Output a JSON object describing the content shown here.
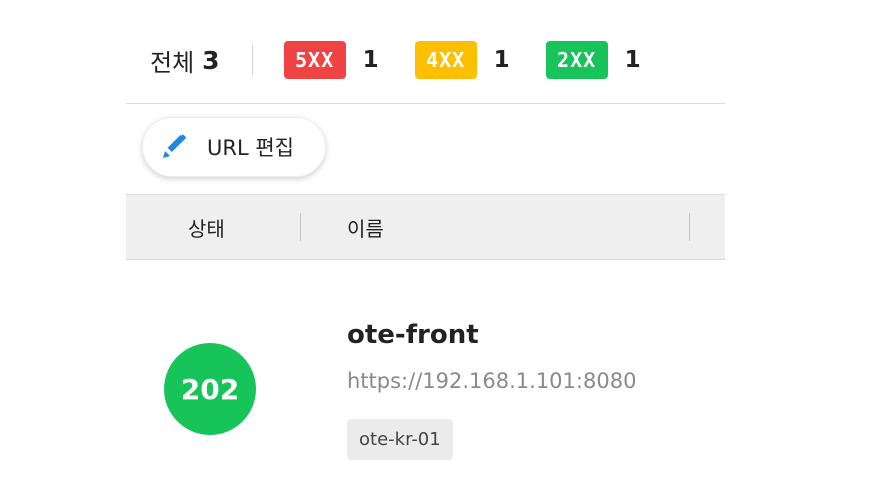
{
  "summary": {
    "total_label": "전체",
    "total_count": "3",
    "badges": [
      {
        "label": "5XX",
        "count": "1",
        "color": "#f04444"
      },
      {
        "label": "4XX",
        "count": "1",
        "color": "#fdc000"
      },
      {
        "label": "2XX",
        "count": "1",
        "color": "#16c45a"
      }
    ]
  },
  "toolbar": {
    "edit_url_label": "URL 편집",
    "edit_icon": "pencil-icon",
    "edit_icon_color": "#1e88e5"
  },
  "table": {
    "columns": [
      "상태",
      "이름"
    ],
    "rows": [
      {
        "status": "202",
        "status_color": "#16c45a",
        "name": "ote-front",
        "url": "https://192.168.1.101:8080",
        "tag": "ote-kr-01"
      }
    ]
  }
}
